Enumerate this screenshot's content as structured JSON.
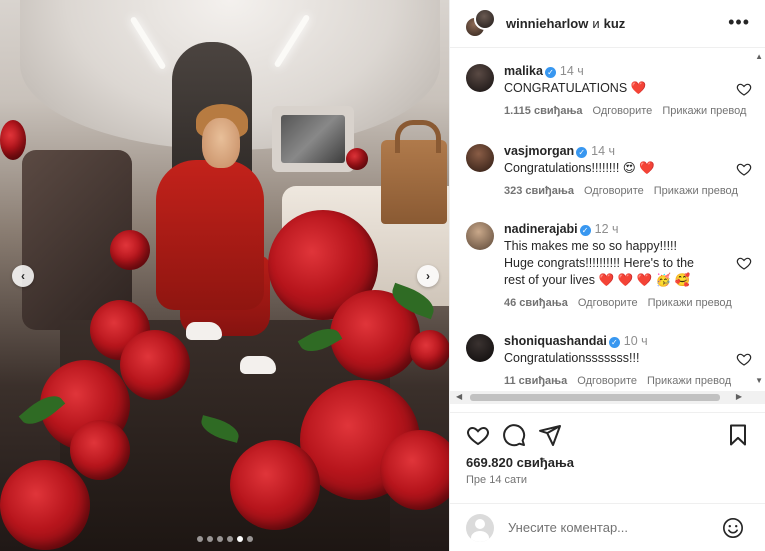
{
  "post": {
    "authors": {
      "primary": "winnieharlow",
      "conjunction": "и",
      "secondary": "kuz"
    },
    "more_icon": "more-horizontal-icon",
    "likes_text": "669.820 свиђања",
    "time_ago": "Пре 14 сати",
    "carousel": {
      "slide_count": 6,
      "active_index": 4
    }
  },
  "comments": [
    {
      "user": "malika",
      "verified": true,
      "time": "14 ч",
      "text": "CONGRATULATIONS ❤️",
      "likes": "1.115 свиђања",
      "reply": "Одговорите",
      "translate": "Прикажи превод"
    },
    {
      "user": "vasjmorgan",
      "verified": true,
      "time": "14 ч",
      "text": "Congratulations!!!!!!!! 😍 ❤️",
      "likes": "323 свиђања",
      "reply": "Одговорите",
      "translate": "Прикажи превод"
    },
    {
      "user": "nadinerajabi",
      "verified": true,
      "time": "12 ч",
      "text": "This makes me so so happy!!!!!\nHuge congrats!!!!!!!!!! Here's to the\nrest of your lives ❤️ ❤️ ❤️ 🥳 🥰",
      "likes": "46 свиђања",
      "reply": "Одговорите",
      "translate": "Прикажи превод"
    },
    {
      "user": "shoniquashandai",
      "verified": true,
      "time": "10 ч",
      "text": "Congratulationsssssss!!!",
      "likes": "11 свиђања",
      "reply": "Одговорите",
      "translate": "Прикажи превод"
    }
  ],
  "comment_input": {
    "placeholder": "Унесите коментар..."
  },
  "colors": {
    "verified": "#3897f0",
    "heart": "#e0202b",
    "text": "#262626",
    "muted": "#737373"
  }
}
